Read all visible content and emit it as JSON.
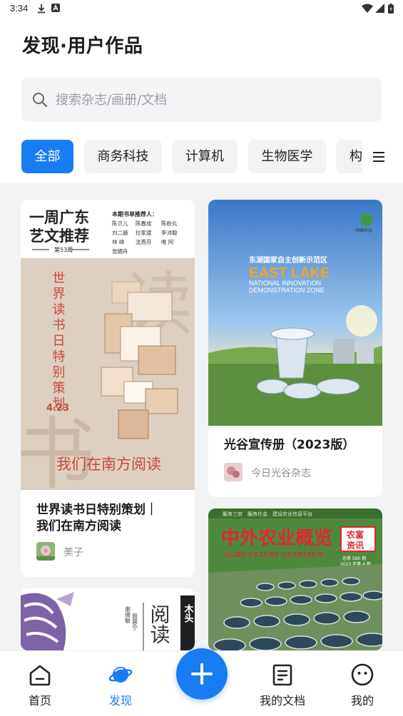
{
  "status_bar": {
    "time": "3:34"
  },
  "header": {
    "title": "发现·用户作品"
  },
  "search": {
    "placeholder": "搜索杂志/画册/文档"
  },
  "tabs": [
    {
      "label": "全部",
      "active": true
    },
    {
      "label": "商务科技",
      "active": false
    },
    {
      "label": "计算机",
      "active": false
    },
    {
      "label": "生物医学",
      "active": false
    },
    {
      "label": "构",
      "active": false
    }
  ],
  "cards": [
    {
      "title_line1": "世界读书日特别策划｜",
      "title_line2": "我们在南方阅读",
      "author": "美子",
      "cover": {
        "heading_line1": "一周广东",
        "heading_line2": "艺文推荐",
        "issue": "第53周",
        "recommenders_title": "本期书单推荐人：",
        "recommenders": [
          "陈贝儿",
          "陈春成",
          "陈粉丸",
          "刘二囍",
          "拉家渡",
          "李沛聪",
          "林 峥",
          "沈燕芬",
          "唯 阿",
          "张娟舟"
        ],
        "vertical_text": "世界读书日特别策划",
        "date": "4.23",
        "bottom_text": "我们在南方阅读",
        "big_char_top": "读",
        "big_char_bottom": "书"
      }
    },
    {
      "title": "光谷宣传册（2023版）",
      "author": "今日光谷杂志",
      "cover": {
        "logo_text": "中国光谷",
        "cn_text": "东湖国家自主创新示范区",
        "en_title": "EAST LAKE",
        "en_line1": "NATIONAL INNOVATION",
        "en_line2": "DEMONSTRATION ZONE"
      }
    },
    {
      "cover": {
        "vertical_text": "阅读",
        "side_text": "木头",
        "names": [
          "谢倩敏",
          "聂蓉宁"
        ]
      }
    },
    {
      "cover": {
        "top_strip": "服务三农　服务社会　建设农业信息平台",
        "title": "中外农业概览",
        "badge_line1": "农富",
        "badge_line2": "资讯",
        "en_title": "AGRICULTURE OVERVIEW",
        "issue": "总第 580 期",
        "date": "2023 年第 4 期"
      }
    }
  ],
  "bottom_nav": [
    {
      "label": "首页",
      "icon": "home-icon",
      "active": false
    },
    {
      "label": "发现",
      "icon": "planet-icon",
      "active": true
    },
    {
      "label": "我的文档",
      "icon": "document-icon",
      "active": false
    },
    {
      "label": "我的",
      "icon": "smiley-face-icon",
      "active": false
    }
  ],
  "colors": {
    "accent": "#1a7cf3",
    "background": "#f2f3f5"
  }
}
